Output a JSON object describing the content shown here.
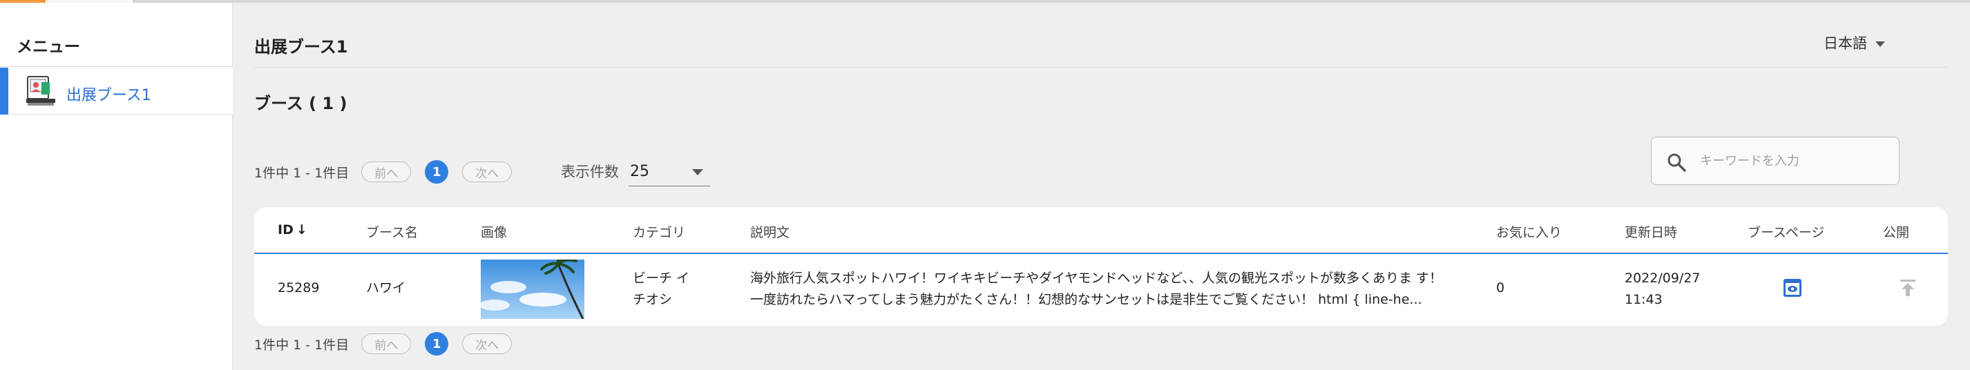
{
  "sidebar": {
    "title": "メニュー",
    "items": [
      {
        "label": "出展ブース1",
        "icon": "booth-icon",
        "active": true
      }
    ]
  },
  "header": {
    "title": "出展ブース1",
    "language": "日本語"
  },
  "section": {
    "title": "ブース ( 1 )"
  },
  "pagination": {
    "range_text": "1件中 1 - 1件目",
    "prev_label": "前へ",
    "next_label": "次へ",
    "current_page": "1"
  },
  "per_page": {
    "label": "表示件数",
    "value": "25"
  },
  "search": {
    "placeholder": "キーワードを入力",
    "value": ""
  },
  "table": {
    "columns": [
      "ID",
      "ブース名",
      "画像",
      "カテゴリ",
      "説明文",
      "お気に入り",
      "更新日時",
      "ブースページ",
      "公開"
    ],
    "sort_indicator": "↓",
    "rows": [
      {
        "id": "25289",
        "name": "ハワイ",
        "category_line1": "ビーチ イ",
        "category_line2": "チオシ",
        "description": "海外旅行人気スポットハワイ！ワイキキビーチやダイヤモンドヘッドなど、、人気の観光スポットが数多くありま す！一度訪れたらハマってしまう魅力がたくさん！！幻想的なサンセットは是非生でご覧ください！ html { line-he...",
        "favorites": "0",
        "updated_date": "2022/09/27",
        "updated_time": "11:43"
      }
    ]
  },
  "colors": {
    "accent": "#2f7fe0",
    "brand_orange": "#f39a3a"
  }
}
